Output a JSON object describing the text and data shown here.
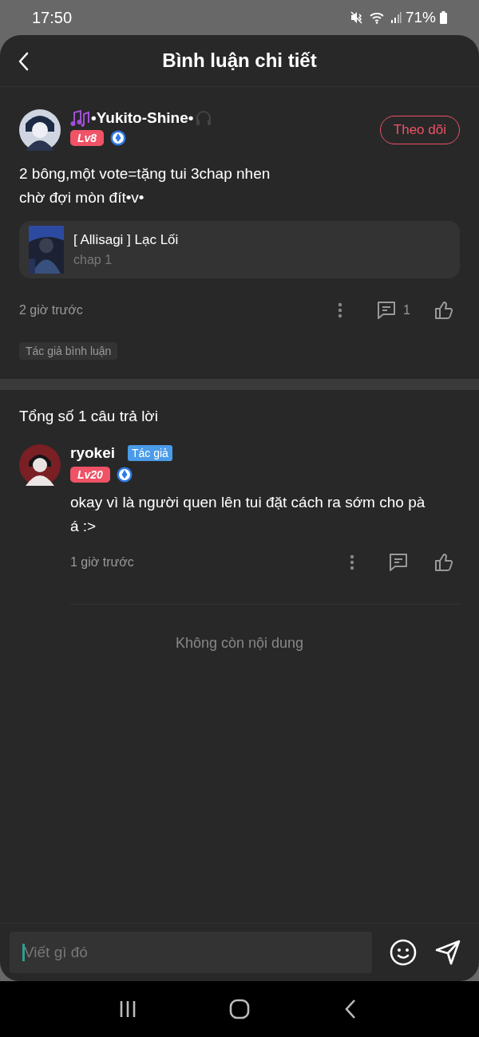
{
  "status_bar": {
    "time": "17:50",
    "battery": "71%"
  },
  "header": {
    "title": "Bình luận chi tiết"
  },
  "comment": {
    "username": "•Yukito-Shine•",
    "level": "Lv8",
    "follow": {
      "label": "Theo dõi",
      "following": false
    },
    "text": "2 bông,một vote=tặng tui 3chap nhen\nchờ đợi mòn đít•v•",
    "work": {
      "title": "[ Allisagi ] Lạc Lối",
      "chapter": "chap 1"
    },
    "time": "2 giờ trước",
    "reply_count": "1",
    "liked": false,
    "tag": "Tác giả bình luận"
  },
  "replies_heading": "Tổng số 1 câu trả lời",
  "replies": [
    {
      "username": "ryokei",
      "author_tag": "Tác giả",
      "level": "Lv20",
      "text": "okay vì là người quen lên tui đặt cách ra sớm cho pà á :>",
      "time": "1 giờ trước",
      "liked": false
    }
  ],
  "end_note": "Không còn nội dung",
  "composer": {
    "placeholder": "Viết gì đó"
  }
}
